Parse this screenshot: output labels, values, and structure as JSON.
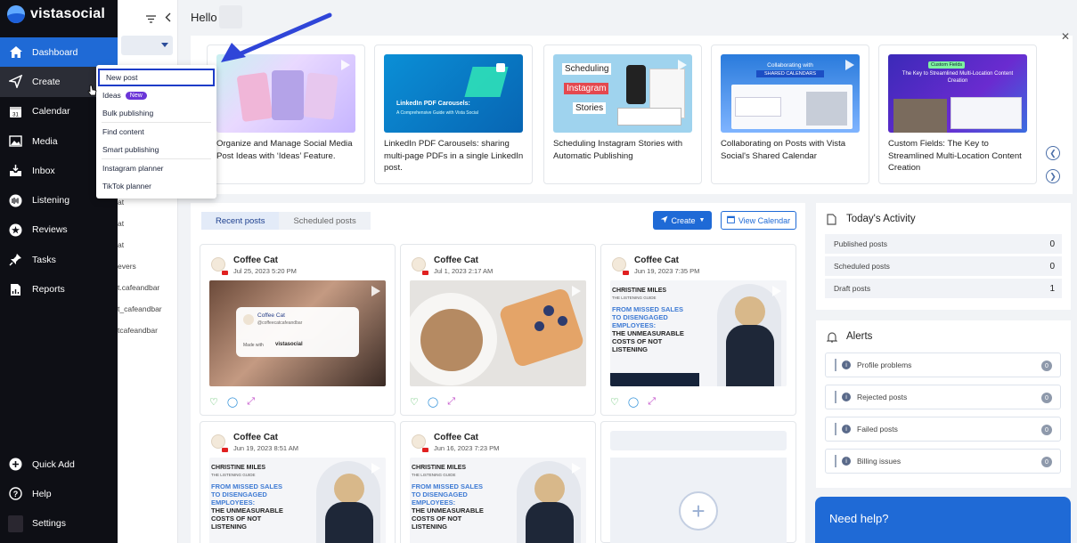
{
  "app": {
    "logo_text": "vistasocial"
  },
  "sidebar": {
    "items": [
      {
        "label": "Dashboard",
        "icon": "home-icon"
      },
      {
        "label": "Create",
        "icon": "send-icon"
      },
      {
        "label": "Calendar",
        "icon": "calendar-icon"
      },
      {
        "label": "Media",
        "icon": "image-icon"
      },
      {
        "label": "Inbox",
        "icon": "inbox-icon"
      },
      {
        "label": "Listening",
        "icon": "listening-icon"
      },
      {
        "label": "Reviews",
        "icon": "star-icon"
      },
      {
        "label": "Tasks",
        "icon": "pin-icon"
      },
      {
        "label": "Reports",
        "icon": "reports-icon"
      }
    ],
    "bottom": [
      {
        "label": "Quick Add",
        "icon": "plus-circle-icon"
      },
      {
        "label": "Help",
        "icon": "help-icon"
      },
      {
        "label": "Settings",
        "icon": "avatar"
      }
    ]
  },
  "subpanel": {
    "items": [
      "at",
      "at",
      "at",
      "evers",
      "t.cafeandbar",
      "t_cafeandbar",
      "tcafeandbar"
    ]
  },
  "create_menu": {
    "items": [
      "New post",
      "Ideas",
      "Bulk publishing",
      "Find content",
      "Smart publishing",
      "Instagram planner",
      "TikTok planner"
    ],
    "new_badge": "New"
  },
  "header": {
    "greeting": "Hello"
  },
  "carousel": {
    "cards": [
      {
        "caption": "Organize and Manage Social Media Post Ideas with ‘Ideas’ Feature."
      },
      {
        "caption": "LinkedIn PDF Carousels: sharing multi-page PDFs in a single LinkedIn post.",
        "thumb_title": "LinkedIn PDF Carousels:",
        "thumb_sub": "A Comprehensive Guide with Vista Social"
      },
      {
        "caption": "Scheduling Instagram Stories with Automatic Publishing",
        "thumb_words": [
          "Scheduling",
          "Instagram",
          "Stories"
        ]
      },
      {
        "caption": "Collaborating on Posts with Vista Social's Shared Calendar",
        "thumb_title": "Collaborating with",
        "thumb_sub": "SHARED CALENDARS"
      },
      {
        "caption": "Custom Fields: The Key to Streamlined Multi-Location Content Creation",
        "thumb_tag": "Custom Fields",
        "thumb_title": "The Key to Streamlined Multi-Location Content Creation"
      }
    ]
  },
  "posts": {
    "tabs": [
      "Recent posts",
      "Scheduled posts"
    ],
    "create_label": "Create",
    "calendar_label": "View Calendar",
    "items": [
      {
        "name": "Coffee Cat",
        "date": "Jul 25, 2023 5:20 PM"
      },
      {
        "name": "Coffee Cat",
        "date": "Jul 1, 2023 2:17 AM"
      },
      {
        "name": "Coffee Cat",
        "date": "Jun 19, 2023 7:35 PM"
      },
      {
        "name": "Coffee Cat",
        "date": "Jun 19, 2023 8:51 AM"
      },
      {
        "name": "Coffee Cat",
        "date": "Jun 16, 2023 7:23 PM"
      }
    ],
    "post1_overlay": {
      "name": "Coffee Cat",
      "handle": "@coffeecatcafeandbar",
      "made_with": "Made with",
      "brand": "vistasocial"
    },
    "christine": {
      "name": "CHRISTINE MILES",
      "guide": "THE LISTENING GUIDE",
      "lines": [
        "FROM MISSED SALES",
        "TO DISENGAGED",
        "EMPLOYEES:",
        "THE UNMEASURABLE",
        "COSTS OF NOT",
        "LISTENING"
      ]
    }
  },
  "activity": {
    "title": "Today's Activity",
    "rows": [
      {
        "label": "Published posts",
        "value": "0"
      },
      {
        "label": "Scheduled posts",
        "value": "0"
      },
      {
        "label": "Draft posts",
        "value": "1"
      }
    ]
  },
  "alerts": {
    "title": "Alerts",
    "rows": [
      {
        "label": "Profile problems",
        "count": "0"
      },
      {
        "label": "Rejected posts",
        "count": "0"
      },
      {
        "label": "Failed posts",
        "count": "0"
      },
      {
        "label": "Billing issues",
        "count": "0"
      }
    ]
  },
  "help": {
    "label": "Need help?"
  }
}
